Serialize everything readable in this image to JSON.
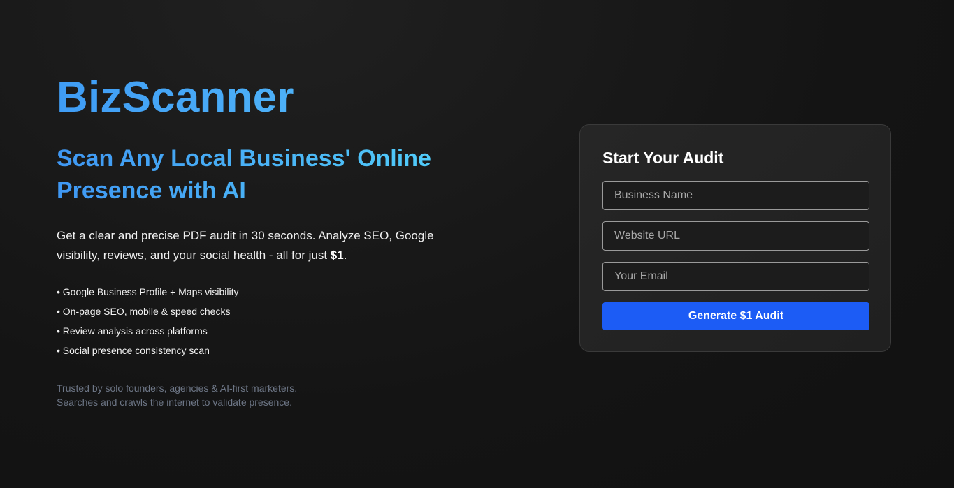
{
  "hero": {
    "brand": "BizScanner",
    "headline": "Scan Any Local Business' Online Presence with AI",
    "description_text": "Get a clear and precise PDF audit in 30 seconds. Analyze SEO, Google visibility, reviews, and your social health - all for just ",
    "description_price": "$1",
    "description_end": ".",
    "features": [
      "• Google Business Profile + Maps visibility",
      "• On-page SEO, mobile & speed checks",
      "• Review analysis across platforms",
      "• Social presence consistency scan"
    ],
    "trust_line_1": "Trusted by solo founders, agencies & AI-first marketers.",
    "trust_line_2": "Searches and crawls the internet to validate presence."
  },
  "form": {
    "title": "Start Your Audit",
    "business_name": {
      "value": "",
      "placeholder": "Business Name"
    },
    "website_url": {
      "value": "",
      "placeholder": "Website URL"
    },
    "email": {
      "value": "",
      "placeholder": "Your Email"
    },
    "submit_label": "Generate $1 Audit"
  },
  "colors": {
    "background": "#141414",
    "accent_blue": "#1c5cf5",
    "brand_gradient_start": "#3f9cf5",
    "brand_gradient_end": "#52d2fb",
    "muted_text": "#6d7686"
  }
}
